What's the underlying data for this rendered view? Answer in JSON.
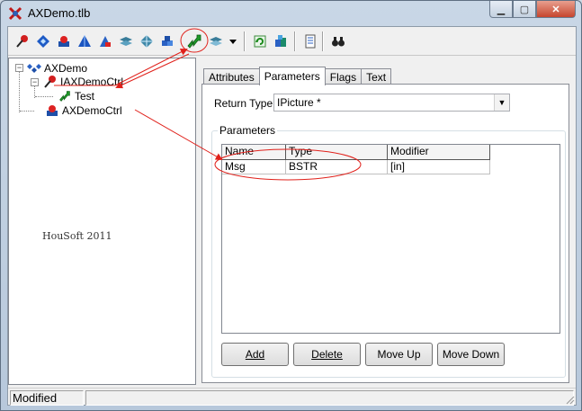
{
  "window": {
    "title": "AXDemo.tlb"
  },
  "colors": {
    "annotation_red": "#e0201a",
    "titlebar": "#c9d7e6"
  },
  "toolbar": {
    "icons": [
      "pin-icon",
      "diamond-icon",
      "cube-stack-icon",
      "pyramid-icon",
      "cube-blue-icon",
      "layers-icon",
      "gem-icon",
      "cubes-icon",
      "green-arrow-icon",
      "layers-dropdown-icon",
      "chevron-down-icon",
      "refresh-icon",
      "registry-icon",
      "document-icon",
      "binoculars-icon"
    ]
  },
  "tree": {
    "root": "AXDemo",
    "interface": "IAXDemoCtrl",
    "method": "Test",
    "coclass": "AXDemoCtrl"
  },
  "watermark": "HouSoft 2011",
  "tabs": [
    {
      "label": "Attributes"
    },
    {
      "label": "Parameters",
      "active": true
    },
    {
      "label": "Flags"
    },
    {
      "label": "Text"
    }
  ],
  "return_type": {
    "label": "Return Type:",
    "value": "IPicture *"
  },
  "parameters": {
    "title": "Parameters",
    "columns": [
      "Name",
      "Type",
      "Modifier"
    ],
    "rows": [
      {
        "name": "Msg",
        "type": "BSTR",
        "modifier": "[in]"
      }
    ]
  },
  "buttons": {
    "add": "Add",
    "delete": "Delete",
    "move_up": "Move Up",
    "move_down": "Move Down"
  },
  "status": {
    "text": "Modified"
  }
}
